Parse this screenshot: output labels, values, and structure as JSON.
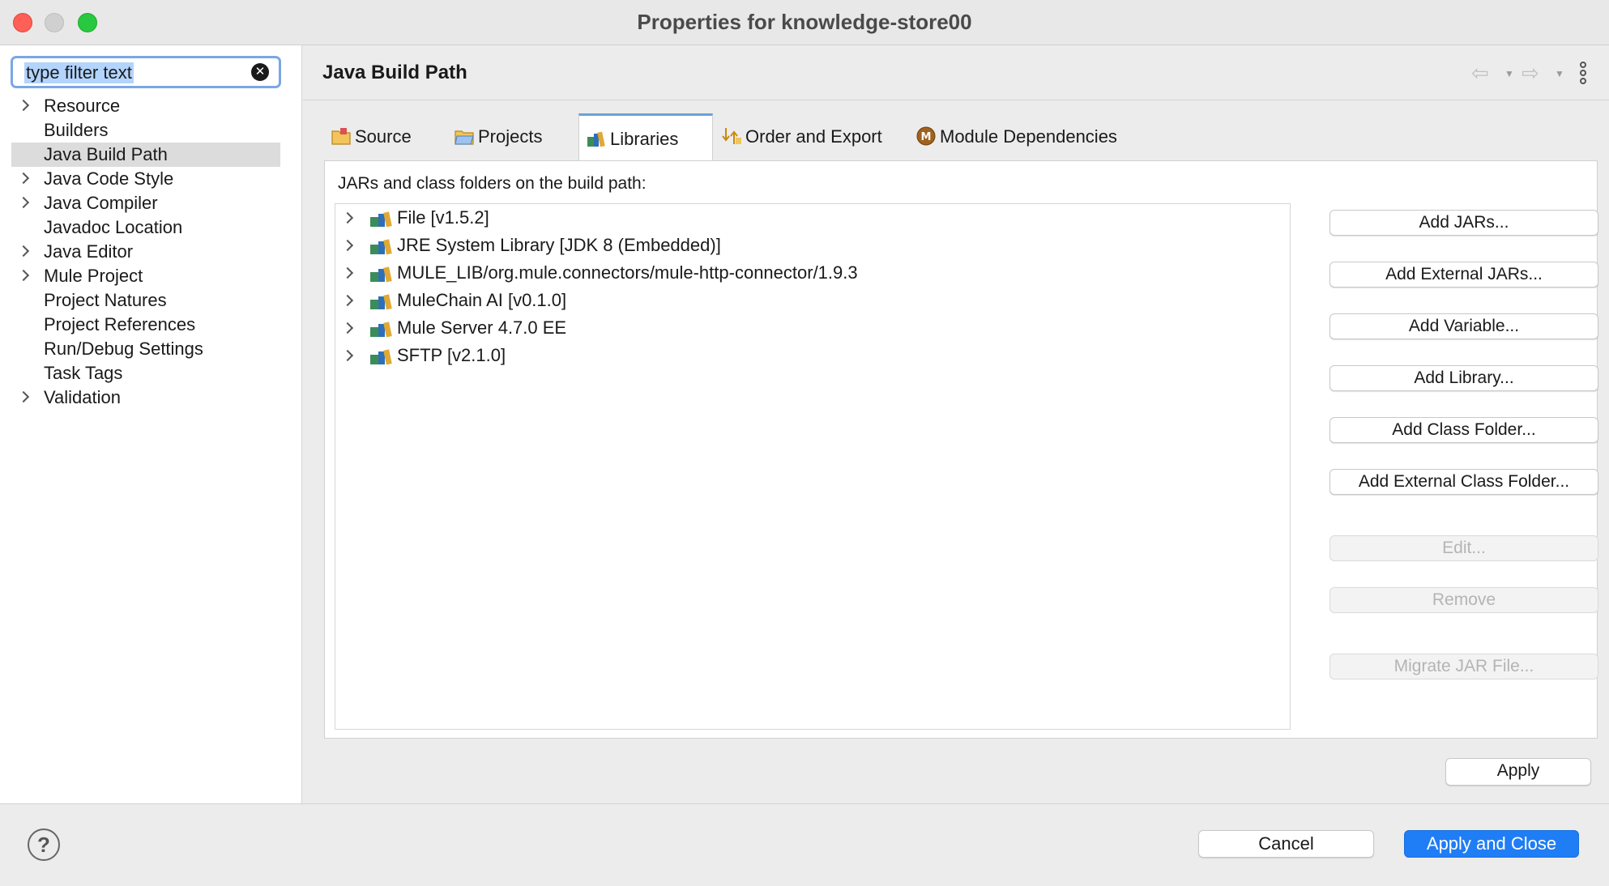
{
  "window": {
    "title": "Properties for knowledge-store00"
  },
  "filter": {
    "value": "type filter text"
  },
  "sidebar": {
    "items": [
      {
        "label": "Resource",
        "expandable": true
      },
      {
        "label": "Builders",
        "expandable": false
      },
      {
        "label": "Java Build Path",
        "expandable": false,
        "selected": true
      },
      {
        "label": "Java Code Style",
        "expandable": true
      },
      {
        "label": "Java Compiler",
        "expandable": true
      },
      {
        "label": "Javadoc Location",
        "expandable": false
      },
      {
        "label": "Java Editor",
        "expandable": true
      },
      {
        "label": "Mule Project",
        "expandable": true
      },
      {
        "label": "Project Natures",
        "expandable": false
      },
      {
        "label": "Project References",
        "expandable": false
      },
      {
        "label": "Run/Debug Settings",
        "expandable": false
      },
      {
        "label": "Task Tags",
        "expandable": false
      },
      {
        "label": "Validation",
        "expandable": true
      }
    ]
  },
  "page": {
    "title": "Java Build Path"
  },
  "tabs": [
    {
      "label": "Source",
      "icon": "source-folder-icon"
    },
    {
      "label": "Projects",
      "icon": "projects-folder-icon"
    },
    {
      "label": "Libraries",
      "icon": "libraries-icon",
      "active": true
    },
    {
      "label": "Order and Export",
      "icon": "order-export-icon"
    },
    {
      "label": "Module Dependencies",
      "icon": "module-icon"
    }
  ],
  "libraries": {
    "section_label": "JARs and class folders on the build path:",
    "items": [
      "File [v1.5.2]",
      "JRE System Library [JDK 8 (Embedded)]",
      "MULE_LIB/org.mule.connectors/mule-http-connector/1.9.3",
      "MuleChain AI [v0.1.0]",
      "Mule Server 4.7.0 EE",
      "SFTP [v2.1.0]"
    ]
  },
  "buttons": {
    "add_jars": "Add JARs...",
    "add_external_jars": "Add External JARs...",
    "add_variable": "Add Variable...",
    "add_library": "Add Library...",
    "add_class_folder": "Add Class Folder...",
    "add_external_class_folder": "Add External Class Folder...",
    "edit": "Edit...",
    "remove": "Remove",
    "migrate_jar": "Migrate JAR File...",
    "apply": "Apply"
  },
  "footer": {
    "help": "?",
    "cancel": "Cancel",
    "apply_and_close": "Apply and Close"
  },
  "colors": {
    "primary_button": "#1f7df5",
    "active_tab_accent": "#6ba2d8",
    "selection": "#dcdcdc"
  }
}
